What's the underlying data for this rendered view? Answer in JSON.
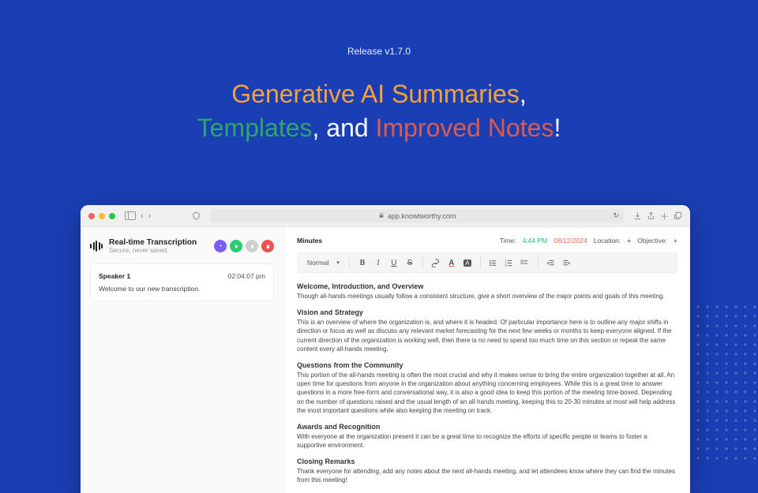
{
  "hero": {
    "release": "Release v1.7.0",
    "parts": {
      "p1": "Generative AI Summaries",
      "comma1": ", ",
      "p2": "Templates",
      "comma2": ", and ",
      "p3": "Improved Notes",
      "bang": "!"
    }
  },
  "browser": {
    "url": "app.knowtworthy.com"
  },
  "transcription": {
    "title": "Real-time Transcription",
    "subtitle": "Secure, never saved.",
    "speaker": "Speaker 1",
    "timestamp": "02:04:07 pm",
    "text": "Welcome to our new transcription."
  },
  "editor": {
    "section_title": "Minutes",
    "meta": {
      "time_label": "Time:",
      "time_value": "4:44 PM",
      "date_value": "08/12/2024",
      "location_label": "Location:",
      "objective_label": "Objective:"
    },
    "format_select": "Normal",
    "sections": [
      {
        "h": "Welcome, Introduction, and Overview",
        "p": "Though all-hands meetings usually follow a consistent structure, give a short overview of the major points and goals of this meeting."
      },
      {
        "h": "Vision and Strategy",
        "p": "This is an overview of where the organization is, and where it is headed. Of particular importance here is to outline any major shifts in direction or focus as well as discuss any relevant market forecasting for the next few weeks or months to keep everyone aligned. If the current direction of the organization is working well, then there is no need to spend too much time on this section or repeat the same content every all-hands meeting."
      },
      {
        "h": "Questions from the Community",
        "p": "This portion of the all-hands meeting is often the most crucial and why it makes sense to bring the entire organization together at all. An open time for questions from anyone in the organization about anything concerning employees. While this is a great time to answer questions in a more free-form and conversational way, it is also a good idea to keep this portion of the meeting time-boxed. Depending on the number of questions raised and the usual length of an all-hands meeting, keeping this to 20-30 minutes at most will help address the most important questions while also keeping the meeting on track."
      },
      {
        "h": "Awards and Recognition",
        "p": "With everyone at the organization present it can be a great time to recognize the efforts of specific people or teams to foster a supportive environment."
      },
      {
        "h": "Closing Remarks",
        "p": "Thank everyone for attending, add any notes about the next all-hands meeting, and let attendees know where they can find the minutes from this meeting!"
      }
    ]
  }
}
